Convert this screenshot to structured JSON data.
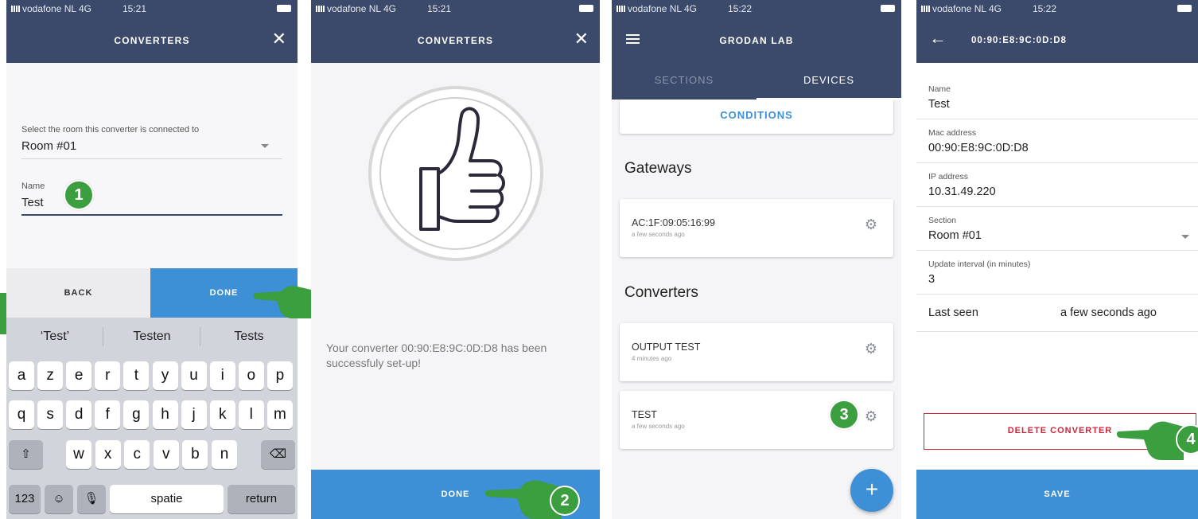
{
  "screen1": {
    "status": {
      "carrier": "vodafone NL  4G",
      "time": "15:21"
    },
    "title": "CONVERTERS",
    "room_label": "Select the room this converter is connected to",
    "room_value": "Room #01",
    "name_label": "Name",
    "name_value": "Test",
    "back_button": "BACK",
    "done_button": "DONE",
    "keyboard": {
      "suggestions": [
        "‘Test’",
        "Testen",
        "Tests"
      ],
      "row1": [
        "a",
        "z",
        "e",
        "r",
        "t",
        "y",
        "u",
        "i",
        "o",
        "p"
      ],
      "row2": [
        "q",
        "s",
        "d",
        "f",
        "g",
        "h",
        "j",
        "k",
        "l",
        "m"
      ],
      "row3": [
        "w",
        "x",
        "c",
        "v",
        "b",
        "n"
      ],
      "numbers_key": "123",
      "space_key": "spatie",
      "return_key": "return"
    }
  },
  "screen2": {
    "status": {
      "carrier": "vodafone NL  4G",
      "time": "15:21"
    },
    "title": "CONVERTERS",
    "message": "Your converter 00:90:E8:9C:0D:D8 has been successfuly set-up!",
    "done_button": "DONE"
  },
  "screen3": {
    "status": {
      "carrier": "vodafone NL  4G",
      "time": "15:22"
    },
    "title": "GRODAN LAB",
    "tabs": [
      "SECTIONS",
      "DEVICES"
    ],
    "conditions_button": "CONDITIONS",
    "gateways_heading": "Gateways",
    "gateways": [
      {
        "name": "AC:1F:09:05:16:99",
        "seen": "a few seconds ago"
      }
    ],
    "converters_heading": "Converters",
    "converters": [
      {
        "name": "OUTPUT TEST",
        "seen": "4 minutes ago"
      },
      {
        "name": "TEST",
        "seen": "a few seconds ago"
      }
    ],
    "fab_label": "+"
  },
  "screen4": {
    "status": {
      "carrier": "vodafone NL  4G",
      "time": "15:22"
    },
    "title": "00:90:E8:9C:0D:D8",
    "fields": [
      {
        "label": "Name",
        "value": "Test"
      },
      {
        "label": "Mac address",
        "value": "00:90:E8:9C:0D:D8"
      },
      {
        "label": "IP address",
        "value": "10.31.49.220"
      },
      {
        "label": "Section",
        "value": "Room #01"
      },
      {
        "label": "Update interval (in minutes)",
        "value": "3"
      }
    ],
    "last_seen_label": "Last seen",
    "last_seen_value": "a few seconds ago",
    "delete_button": "DELETE CONVERTER",
    "save_button": "SAVE"
  },
  "steps": [
    "1",
    "2",
    "3",
    "4"
  ],
  "colors": {
    "app_bar": "#3b4a6b",
    "primary": "#3d8fd6",
    "danger": "#d0253a",
    "step_badge": "#3b9e3f"
  }
}
